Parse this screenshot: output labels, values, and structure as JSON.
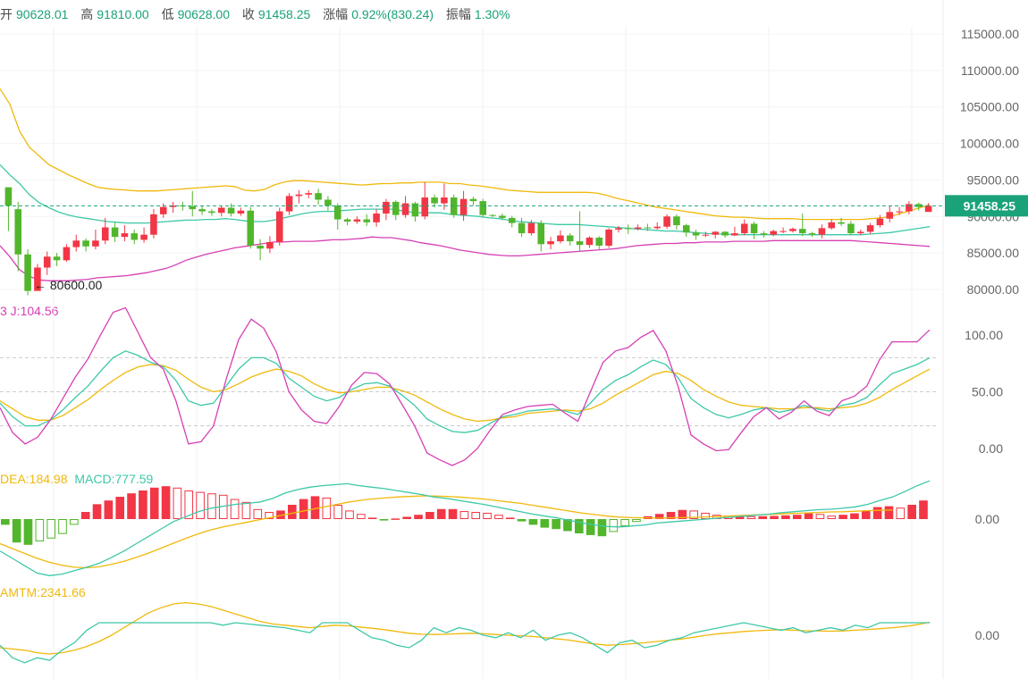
{
  "header": {
    "open_label": "开",
    "open": "90628.01",
    "high_label": "高",
    "high": "91810.00",
    "low_label": "低",
    "low": "90628.00",
    "close_label": "收",
    "close": "91458.25",
    "change_label": "涨幅",
    "change": "0.92%(830.24)",
    "amp_label": "振幅",
    "amp": "1.30%"
  },
  "price_axis": {
    "ticks": [
      "115000.00",
      "110000.00",
      "105000.00",
      "100000.00",
      "95000.00",
      "90000.00",
      "85000.00",
      "80000.00"
    ]
  },
  "current_price": {
    "label": "91458.25",
    "value": 91458.25,
    "color": "#1aa27a"
  },
  "low_marker": {
    "label": "← 80600.00",
    "value": 80600
  },
  "kdj": {
    "label_prefix": "J",
    "label": "3  J:104.56",
    "j_value": "104.56",
    "ticks": [
      "100.00",
      "50.00",
      "0.00"
    ]
  },
  "macd": {
    "dea_label": "DEA:184.98",
    "macd_label": "MACD:777.59",
    "ticks": [
      "0.00"
    ]
  },
  "mtm": {
    "label": "AMTM:2341.66",
    "ticks": [
      "0.00"
    ]
  },
  "colors": {
    "up": "#f23645",
    "down": "#52b62c",
    "upper_band": "#f0b90b",
    "mid_band": "#3dc8a8",
    "lower_band": "#d63fb4",
    "k": "#3dc8a8",
    "d": "#f0b90b",
    "j": "#d63fb4",
    "accent": "#1aa27a"
  },
  "chart_data": {
    "type": "candlestick",
    "title": "",
    "ylim": [
      78000,
      117000
    ],
    "candles": [
      [
        94000,
        91500,
        88000,
        93500
      ],
      [
        91000,
        84800,
        82500,
        92000
      ],
      [
        84800,
        79800,
        79200,
        85500
      ],
      [
        79800,
        83000,
        80600,
        83500
      ],
      [
        83000,
        84500,
        82000,
        85200
      ],
      [
        84500,
        84000,
        83200,
        85000
      ],
      [
        84000,
        85800,
        83800,
        86200
      ],
      [
        85800,
        86700,
        85200,
        87500
      ],
      [
        86700,
        85900,
        85200,
        87000
      ],
      [
        85900,
        86700,
        85500,
        88200
      ],
      [
        86700,
        88500,
        86200,
        89800
      ],
      [
        88500,
        87200,
        86500,
        89200
      ],
      [
        87200,
        87700,
        86600,
        88800
      ],
      [
        87700,
        86800,
        86200,
        88200
      ],
      [
        86800,
        87500,
        86400,
        88500
      ],
      [
        87500,
        90300,
        87000,
        91000
      ],
      [
        90300,
        91300,
        89800,
        91800
      ],
      [
        91300,
        91500,
        90500,
        92000
      ],
      [
        91500,
        91400,
        90800,
        92000
      ],
      [
        91400,
        91000,
        90000,
        93500
      ],
      [
        91000,
        90700,
        90200,
        91500
      ],
      [
        90700,
        90500,
        90100,
        91000
      ],
      [
        90500,
        91200,
        90000,
        91500
      ],
      [
        91200,
        90400,
        90000,
        91800
      ],
      [
        90400,
        90800,
        90100,
        91200
      ],
      [
        90800,
        86000,
        85600,
        91300
      ],
      [
        86000,
        85600,
        84000,
        86900
      ],
      [
        85600,
        86500,
        85000,
        87300
      ],
      [
        86500,
        90700,
        86000,
        91200
      ],
      [
        90700,
        92800,
        90200,
        93200
      ],
      [
        92800,
        93000,
        91800,
        93600
      ],
      [
        93000,
        93200,
        92500,
        93600
      ],
      [
        93200,
        92300,
        91600,
        93800
      ],
      [
        92300,
        91500,
        90800,
        92800
      ],
      [
        91500,
        89600,
        88200,
        91800
      ],
      [
        89600,
        89300,
        88800,
        89800
      ],
      [
        89300,
        89600,
        89000,
        90000
      ],
      [
        89600,
        89200,
        88700,
        90300
      ],
      [
        89200,
        90400,
        88600,
        91000
      ],
      [
        90400,
        92000,
        89500,
        92400
      ],
      [
        92000,
        90200,
        89500,
        92200
      ],
      [
        90200,
        91800,
        89800,
        92800
      ],
      [
        91800,
        90000,
        89300,
        92000
      ],
      [
        90000,
        92600,
        89600,
        94700
      ],
      [
        92600,
        91800,
        91200,
        93000
      ],
      [
        91800,
        92600,
        90900,
        94500
      ],
      [
        92600,
        90200,
        89800,
        93000
      ],
      [
        90200,
        92400,
        89400,
        93500
      ],
      [
        92400,
        92100,
        91500,
        92700
      ],
      [
        92100,
        90200,
        89900,
        92400
      ],
      [
        90200,
        90100,
        89900,
        90300
      ],
      [
        90100,
        89800,
        89500,
        90400
      ],
      [
        89800,
        89100,
        88500,
        90100
      ],
      [
        89100,
        87700,
        87200,
        89800
      ],
      [
        87700,
        89100,
        87400,
        89500
      ],
      [
        89100,
        86200,
        85200,
        89500
      ],
      [
        86200,
        86600,
        85500,
        87200
      ],
      [
        86600,
        87400,
        86300,
        88100
      ],
      [
        87400,
        86600,
        86000,
        87700
      ],
      [
        86600,
        86100,
        85200,
        90700
      ],
      [
        86100,
        87100,
        85700,
        87300
      ],
      [
        87100,
        86000,
        85500,
        87300
      ],
      [
        86000,
        88200,
        85700,
        88400
      ],
      [
        88200,
        88400,
        87800,
        88700
      ],
      [
        88400,
        88300,
        87600,
        88900
      ],
      [
        88300,
        88500,
        88100,
        88900
      ],
      [
        88500,
        88400,
        88000,
        89000
      ],
      [
        88400,
        88600,
        88200,
        89200
      ],
      [
        88600,
        90000,
        88300,
        90300
      ],
      [
        90000,
        88800,
        88200,
        90300
      ],
      [
        88800,
        87800,
        87200,
        89000
      ],
      [
        87800,
        87400,
        86800,
        88200
      ],
      [
        87400,
        87500,
        87200,
        87900
      ],
      [
        87500,
        87900,
        87000,
        88000
      ],
      [
        87900,
        87400,
        87100,
        88000
      ],
      [
        87400,
        87700,
        87300,
        88600
      ],
      [
        87700,
        89000,
        87400,
        89600
      ],
      [
        89000,
        87700,
        86900,
        89300
      ],
      [
        87700,
        87500,
        87100,
        88000
      ],
      [
        87500,
        88000,
        87300,
        88200
      ],
      [
        88000,
        88000,
        87700,
        88500
      ],
      [
        88000,
        88300,
        87800,
        88500
      ],
      [
        88300,
        87700,
        87300,
        90400
      ],
      [
        87700,
        87500,
        87200,
        87900
      ],
      [
        87500,
        88400,
        87000,
        88900
      ],
      [
        88400,
        89200,
        88200,
        89600
      ],
      [
        89200,
        89000,
        88700,
        89800
      ],
      [
        89000,
        87700,
        87400,
        89400
      ],
      [
        87700,
        87900,
        87500,
        88200
      ],
      [
        87900,
        88800,
        87600,
        89100
      ],
      [
        88800,
        89700,
        88500,
        90200
      ],
      [
        89700,
        90600,
        89200,
        91500
      ],
      [
        90600,
        90700,
        90200,
        91300
      ],
      [
        90700,
        91700,
        90300,
        92100
      ],
      [
        91700,
        91300,
        90800,
        91900
      ],
      [
        90628,
        91458,
        90628,
        91810
      ]
    ],
    "bb_upper": [
      107500,
      105400,
      101700,
      99500,
      98300,
      97100,
      96400,
      95700,
      95100,
      94500,
      94000,
      93800,
      93700,
      93600,
      93500,
      93500,
      93500,
      93600,
      93700,
      93800,
      93900,
      94000,
      94100,
      94200,
      94100,
      93600,
      93500,
      93700,
      94300,
      94700,
      94900,
      94900,
      94800,
      94700,
      94600,
      94500,
      94400,
      94300,
      94400,
      94500,
      94500,
      94600,
      94600,
      94700,
      94700,
      94700,
      94500,
      94500,
      94300,
      94200,
      94000,
      93800,
      93600,
      93500,
      93400,
      93300,
      93300,
      93300,
      93300,
      93300,
      93300,
      93200,
      92900,
      92500,
      92200,
      91900,
      91600,
      91300,
      91100,
      90900,
      90700,
      90500,
      90300,
      90100,
      90000,
      89900,
      89900,
      89800,
      89700,
      89700,
      89700,
      89700,
      89600,
      89600,
      89600,
      89600,
      89600,
      89600,
      89600,
      89700,
      89800,
      90000,
      90400,
      90800,
      91200,
      91600
    ],
    "bb_mid": [
      97100,
      95700,
      94500,
      93000,
      91900,
      91200,
      90600,
      90200,
      89900,
      89700,
      89500,
      89300,
      89200,
      89100,
      89100,
      89100,
      89200,
      89300,
      89400,
      89500,
      89500,
      89600,
      89600,
      89700,
      89600,
      89400,
      89300,
      89300,
      89500,
      89800,
      90100,
      90400,
      90600,
      90700,
      90700,
      90800,
      90900,
      91000,
      91000,
      91000,
      91000,
      90800,
      90600,
      90500,
      90500,
      90500,
      90300,
      90200,
      90100,
      90000,
      89800,
      89700,
      89500,
      89300,
      89200,
      89100,
      89000,
      88900,
      88900,
      88900,
      88800,
      88700,
      88600,
      88500,
      88400,
      88300,
      88200,
      88100,
      88000,
      88000,
      87900,
      87800,
      87700,
      87600,
      87600,
      87500,
      87500,
      87500,
      87500,
      87500,
      87500,
      87500,
      87500,
      87500,
      87500,
      87500,
      87500,
      87500,
      87500,
      87600,
      87700,
      87800,
      88000,
      88200,
      88400,
      88600
    ],
    "bb_lower": [
      86000,
      84500,
      82700,
      81800,
      81300,
      81200,
      81200,
      81200,
      81300,
      81400,
      81600,
      81700,
      81800,
      81900,
      82100,
      82300,
      82600,
      82900,
      83400,
      84000,
      84400,
      84800,
      85100,
      85400,
      85700,
      85900,
      86100,
      86300,
      86500,
      86500,
      86600,
      86600,
      86600,
      86700,
      86800,
      86800,
      86900,
      87000,
      87200,
      87100,
      87100,
      86900,
      86700,
      86400,
      86200,
      86000,
      85700,
      85400,
      85200,
      85000,
      84800,
      84700,
      84600,
      84600,
      84700,
      84800,
      84900,
      85000,
      85100,
      85200,
      85300,
      85400,
      85500,
      85600,
      85800,
      86000,
      86100,
      86200,
      86300,
      86300,
      86400,
      86400,
      86500,
      86500,
      86500,
      86600,
      86600,
      86600,
      86600,
      86700,
      86700,
      86700,
      86700,
      86700,
      86700,
      86700,
      86700,
      86700,
      86600,
      86500,
      86400,
      86300,
      86200,
      86100,
      86000,
      85900
    ],
    "kdj_k": [
      40,
      28,
      20,
      20,
      25,
      34,
      45,
      55,
      68,
      80,
      86,
      82,
      76,
      72,
      60,
      42,
      38,
      40,
      55,
      70,
      80,
      80,
      75,
      62,
      54,
      46,
      42,
      45,
      52,
      57,
      58,
      55,
      47,
      38,
      26,
      20,
      15,
      14,
      16,
      22,
      28,
      30,
      33,
      34,
      35,
      33,
      30,
      40,
      52,
      60,
      65,
      72,
      78,
      74,
      62,
      44,
      36,
      30,
      27,
      30,
      34,
      36,
      32,
      34,
      38,
      35,
      33,
      38,
      40,
      45,
      56,
      66,
      70,
      74,
      80
    ],
    "kdj_d": [
      42,
      35,
      28,
      25,
      25,
      29,
      36,
      43,
      52,
      60,
      67,
      72,
      74,
      73,
      69,
      61,
      54,
      50,
      52,
      57,
      63,
      67,
      70,
      68,
      64,
      57,
      52,
      49,
      50,
      52,
      54,
      54,
      51,
      47,
      41,
      35,
      30,
      26,
      24,
      25,
      27,
      28,
      31,
      32,
      33,
      34,
      33,
      35,
      40,
      47,
      53,
      59,
      65,
      68,
      66,
      60,
      52,
      46,
      41,
      38,
      37,
      36,
      35,
      35,
      36,
      36,
      35,
      36,
      37,
      40,
      45,
      52,
      58,
      64,
      70
    ],
    "kdj_j": [
      36,
      14,
      4,
      10,
      25,
      44,
      63,
      79,
      100,
      120,
      124,
      102,
      80,
      70,
      42,
      4,
      6,
      20,
      61,
      96,
      114,
      106,
      85,
      50,
      34,
      24,
      22,
      37,
      56,
      67,
      66,
      57,
      39,
      20,
      -4,
      -10,
      -15,
      -10,
      0,
      16,
      30,
      34,
      37,
      38,
      39,
      31,
      24,
      50,
      76,
      86,
      89,
      98,
      104,
      86,
      54,
      12,
      4,
      -2,
      -1,
      14,
      28,
      36,
      26,
      32,
      42,
      33,
      29,
      42,
      46,
      55,
      78,
      94,
      94,
      94,
      104.56
    ],
    "macd_hist": [
      -200,
      -820,
      -900,
      -780,
      -680,
      -520,
      -200,
      250,
      520,
      650,
      780,
      900,
      1000,
      1100,
      1150,
      1100,
      1000,
      950,
      900,
      850,
      700,
      600,
      350,
      250,
      300,
      500,
      700,
      800,
      750,
      500,
      300,
      180,
      50,
      -50,
      20,
      80,
      150,
      250,
      350,
      350,
      280,
      250,
      220,
      150,
      50,
      -80,
      -200,
      -300,
      -350,
      -420,
      -500,
      -560,
      -600,
      -450,
      -250,
      -100,
      100,
      180,
      250,
      320,
      300,
      220,
      150,
      120,
      120,
      100,
      100,
      110,
      130,
      150,
      200,
      180,
      120,
      150,
      200,
      300,
      420,
      450,
      400,
      500,
      650
    ],
    "macd_dif": [
      -650,
      -800,
      -950,
      -1100,
      -1150,
      -1120,
      -1050,
      -980,
      -900,
      -780,
      -650,
      -500,
      -350,
      -200,
      -50,
      50,
      150,
      220,
      260,
      300,
      320,
      350,
      420,
      530,
      600,
      650,
      680,
      700,
      720,
      680,
      650,
      620,
      580,
      540,
      500,
      450,
      420,
      380,
      340,
      300,
      250,
      200,
      150,
      100,
      60,
      20,
      -30,
      -80,
      -120,
      -150,
      -160,
      -140,
      -120,
      -80,
      -60,
      -40,
      -20,
      0,
      20,
      40,
      60,
      80,
      100,
      130,
      150,
      170,
      190,
      200,
      220,
      250,
      300,
      380,
      450,
      560,
      680,
      777.59
    ],
    "macd_dea": [
      -500,
      -600,
      -700,
      -800,
      -880,
      -940,
      -980,
      -990,
      -970,
      -920,
      -860,
      -780,
      -690,
      -590,
      -490,
      -390,
      -300,
      -220,
      -160,
      -110,
      -60,
      -10,
      40,
      90,
      140,
      190,
      240,
      290,
      340,
      380,
      410,
      430,
      450,
      460,
      470,
      470,
      460,
      450,
      430,
      410,
      380,
      350,
      320,
      280,
      240,
      200,
      160,
      120,
      90,
      60,
      40,
      30,
      25,
      20,
      25,
      30,
      35,
      45,
      55,
      65,
      75,
      85,
      95,
      105,
      115,
      125,
      135,
      145,
      150,
      160,
      170,
      178,
      184.98
    ],
    "mtm": [
      -400,
      -900,
      -1100,
      -900,
      -1000,
      -600,
      -300,
      200,
      800,
      1100,
      1700,
      1500,
      1600,
      1300,
      1100,
      800,
      700,
      500,
      400,
      500,
      450,
      400,
      350,
      300,
      200,
      100,
      600,
      650,
      500,
      200,
      -100,
      -200,
      -400,
      -500,
      -200,
      300,
      100,
      300,
      200,
      0,
      -100,
      100,
      -100,
      200,
      -200,
      0,
      100,
      -100,
      -400,
      -700,
      -300,
      -200,
      -500,
      -400,
      -200,
      -100,
      100,
      200,
      300,
      400,
      500,
      400,
      300,
      200,
      300,
      100,
      200,
      300,
      200,
      400,
      300,
      500,
      600,
      700,
      1000,
      2341.66
    ],
    "mamtm": [
      -500,
      -550,
      -600,
      -700,
      -750,
      -700,
      -600,
      -450,
      -250,
      0,
      300,
      600,
      900,
      1100,
      1250,
      1300,
      1250,
      1150,
      1000,
      850,
      700,
      550,
      450,
      400,
      350,
      300,
      350,
      400,
      380,
      330,
      280,
      220,
      150,
      80,
      40,
      30,
      40,
      60,
      80,
      60,
      30,
      0,
      -20,
      -50,
      -100,
      -150,
      -200,
      -280,
      -350,
      -400,
      -380,
      -340,
      -300,
      -250,
      -200,
      -150,
      -80,
      0,
      60,
      100,
      150,
      180,
      200,
      220,
      200,
      180,
      170,
      160,
      170,
      200,
      230,
      260,
      300,
      350,
      420,
      520
    ]
  }
}
